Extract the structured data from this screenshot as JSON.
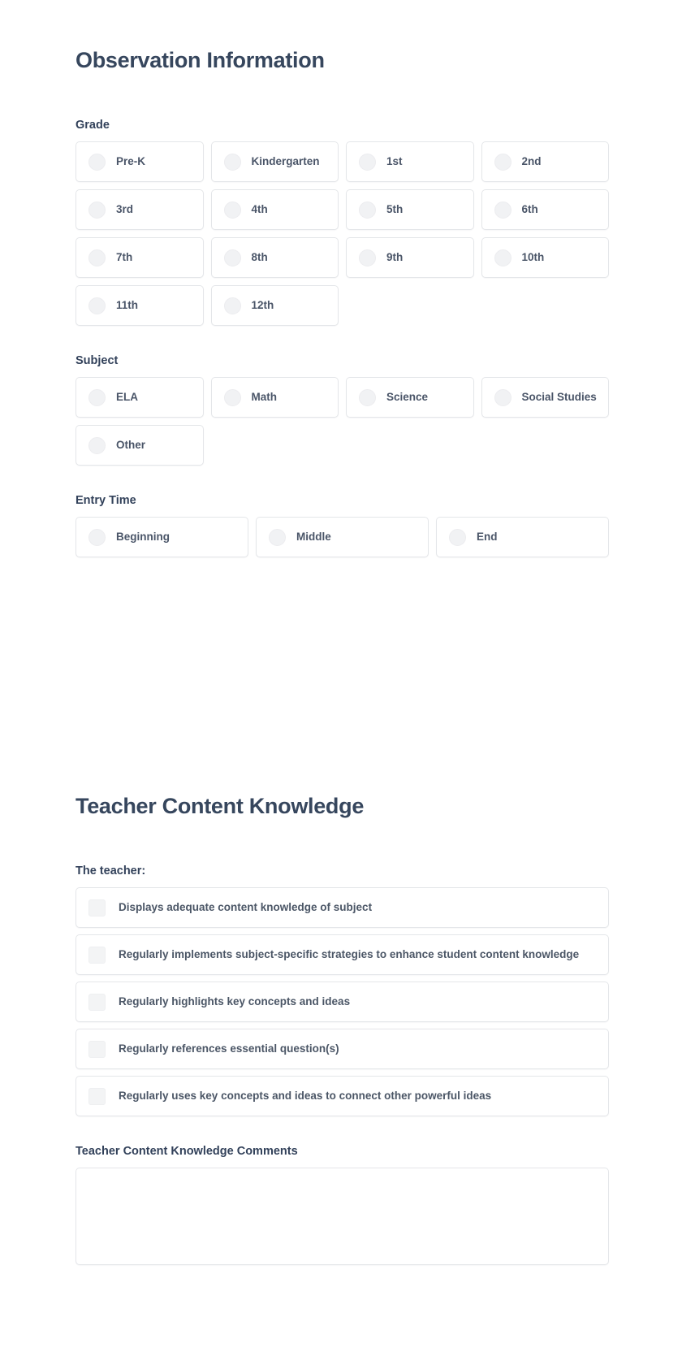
{
  "sections": [
    {
      "title": "Observation Information",
      "groups": [
        {
          "label": "Grade",
          "type": "radio",
          "columns": 4,
          "options": [
            "Pre-K",
            "Kindergarten",
            "1st",
            "2nd",
            "3rd",
            "4th",
            "5th",
            "6th",
            "7th",
            "8th",
            "9th",
            "10th",
            "11th",
            "12th"
          ]
        },
        {
          "label": "Subject",
          "type": "radio",
          "columns": 4,
          "options": [
            "ELA",
            "Math",
            "Science",
            "Social Studies",
            "Other"
          ]
        },
        {
          "label": "Entry Time",
          "type": "radio",
          "columns": 3,
          "options": [
            "Beginning",
            "Middle",
            "End"
          ]
        }
      ]
    },
    {
      "title": "Teacher Content Knowledge",
      "checklist_label": "The teacher:",
      "checklist": [
        "Displays adequate content knowledge of subject",
        "Regularly implements subject-specific strategies to enhance student content knowledge",
        "Regularly highlights key concepts and ideas",
        "Regularly references essential question(s)",
        "Regularly uses key concepts and ideas to connect other powerful ideas"
      ],
      "comments_label": "Teacher Content Knowledge Comments",
      "comments_value": "",
      "comments_placeholder": ""
    }
  ],
  "colors": {
    "heading": "#36465d",
    "label": "#32415a",
    "option_text": "#4a5568",
    "card_border": "#e4e6e9",
    "control_fill": "#f1f2f4",
    "background": "#ffffff"
  }
}
